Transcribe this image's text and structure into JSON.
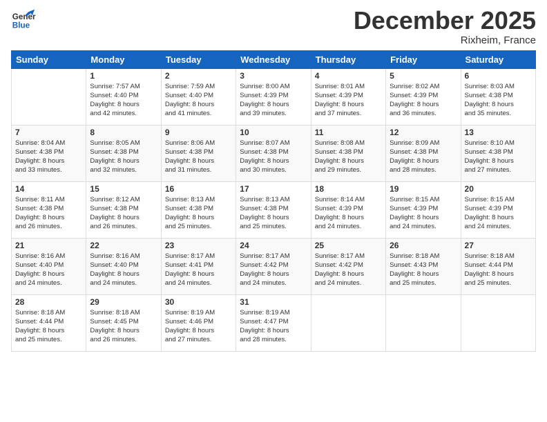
{
  "header": {
    "logo_general": "General",
    "logo_blue": "Blue",
    "month_title": "December 2025",
    "location": "Rixheim, France"
  },
  "weekdays": [
    "Sunday",
    "Monday",
    "Tuesday",
    "Wednesday",
    "Thursday",
    "Friday",
    "Saturday"
  ],
  "weeks": [
    [
      {
        "day": "",
        "info": ""
      },
      {
        "day": "1",
        "info": "Sunrise: 7:57 AM\nSunset: 4:40 PM\nDaylight: 8 hours\nand 42 minutes."
      },
      {
        "day": "2",
        "info": "Sunrise: 7:59 AM\nSunset: 4:40 PM\nDaylight: 8 hours\nand 41 minutes."
      },
      {
        "day": "3",
        "info": "Sunrise: 8:00 AM\nSunset: 4:39 PM\nDaylight: 8 hours\nand 39 minutes."
      },
      {
        "day": "4",
        "info": "Sunrise: 8:01 AM\nSunset: 4:39 PM\nDaylight: 8 hours\nand 37 minutes."
      },
      {
        "day": "5",
        "info": "Sunrise: 8:02 AM\nSunset: 4:39 PM\nDaylight: 8 hours\nand 36 minutes."
      },
      {
        "day": "6",
        "info": "Sunrise: 8:03 AM\nSunset: 4:38 PM\nDaylight: 8 hours\nand 35 minutes."
      }
    ],
    [
      {
        "day": "7",
        "info": "Sunrise: 8:04 AM\nSunset: 4:38 PM\nDaylight: 8 hours\nand 33 minutes."
      },
      {
        "day": "8",
        "info": "Sunrise: 8:05 AM\nSunset: 4:38 PM\nDaylight: 8 hours\nand 32 minutes."
      },
      {
        "day": "9",
        "info": "Sunrise: 8:06 AM\nSunset: 4:38 PM\nDaylight: 8 hours\nand 31 minutes."
      },
      {
        "day": "10",
        "info": "Sunrise: 8:07 AM\nSunset: 4:38 PM\nDaylight: 8 hours\nand 30 minutes."
      },
      {
        "day": "11",
        "info": "Sunrise: 8:08 AM\nSunset: 4:38 PM\nDaylight: 8 hours\nand 29 minutes."
      },
      {
        "day": "12",
        "info": "Sunrise: 8:09 AM\nSunset: 4:38 PM\nDaylight: 8 hours\nand 28 minutes."
      },
      {
        "day": "13",
        "info": "Sunrise: 8:10 AM\nSunset: 4:38 PM\nDaylight: 8 hours\nand 27 minutes."
      }
    ],
    [
      {
        "day": "14",
        "info": "Sunrise: 8:11 AM\nSunset: 4:38 PM\nDaylight: 8 hours\nand 26 minutes."
      },
      {
        "day": "15",
        "info": "Sunrise: 8:12 AM\nSunset: 4:38 PM\nDaylight: 8 hours\nand 26 minutes."
      },
      {
        "day": "16",
        "info": "Sunrise: 8:13 AM\nSunset: 4:38 PM\nDaylight: 8 hours\nand 25 minutes."
      },
      {
        "day": "17",
        "info": "Sunrise: 8:13 AM\nSunset: 4:38 PM\nDaylight: 8 hours\nand 25 minutes."
      },
      {
        "day": "18",
        "info": "Sunrise: 8:14 AM\nSunset: 4:39 PM\nDaylight: 8 hours\nand 24 minutes."
      },
      {
        "day": "19",
        "info": "Sunrise: 8:15 AM\nSunset: 4:39 PM\nDaylight: 8 hours\nand 24 minutes."
      },
      {
        "day": "20",
        "info": "Sunrise: 8:15 AM\nSunset: 4:39 PM\nDaylight: 8 hours\nand 24 minutes."
      }
    ],
    [
      {
        "day": "21",
        "info": "Sunrise: 8:16 AM\nSunset: 4:40 PM\nDaylight: 8 hours\nand 24 minutes."
      },
      {
        "day": "22",
        "info": "Sunrise: 8:16 AM\nSunset: 4:40 PM\nDaylight: 8 hours\nand 24 minutes."
      },
      {
        "day": "23",
        "info": "Sunrise: 8:17 AM\nSunset: 4:41 PM\nDaylight: 8 hours\nand 24 minutes."
      },
      {
        "day": "24",
        "info": "Sunrise: 8:17 AM\nSunset: 4:42 PM\nDaylight: 8 hours\nand 24 minutes."
      },
      {
        "day": "25",
        "info": "Sunrise: 8:17 AM\nSunset: 4:42 PM\nDaylight: 8 hours\nand 24 minutes."
      },
      {
        "day": "26",
        "info": "Sunrise: 8:18 AM\nSunset: 4:43 PM\nDaylight: 8 hours\nand 25 minutes."
      },
      {
        "day": "27",
        "info": "Sunrise: 8:18 AM\nSunset: 4:44 PM\nDaylight: 8 hours\nand 25 minutes."
      }
    ],
    [
      {
        "day": "28",
        "info": "Sunrise: 8:18 AM\nSunset: 4:44 PM\nDaylight: 8 hours\nand 25 minutes."
      },
      {
        "day": "29",
        "info": "Sunrise: 8:18 AM\nSunset: 4:45 PM\nDaylight: 8 hours\nand 26 minutes."
      },
      {
        "day": "30",
        "info": "Sunrise: 8:19 AM\nSunset: 4:46 PM\nDaylight: 8 hours\nand 27 minutes."
      },
      {
        "day": "31",
        "info": "Sunrise: 8:19 AM\nSunset: 4:47 PM\nDaylight: 8 hours\nand 28 minutes."
      },
      {
        "day": "",
        "info": ""
      },
      {
        "day": "",
        "info": ""
      },
      {
        "day": "",
        "info": ""
      }
    ]
  ]
}
